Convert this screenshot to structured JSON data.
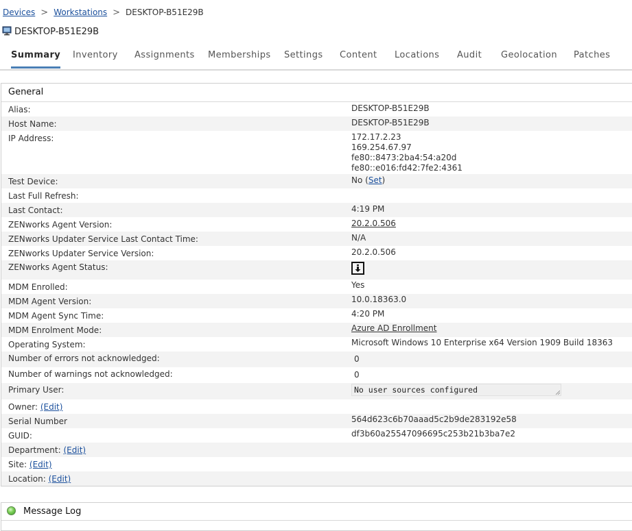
{
  "breadcrumb": {
    "items": [
      "Devices",
      "Workstations"
    ],
    "current": "DESKTOP-B51E29B",
    "separator": ">"
  },
  "page": {
    "title": "DESKTOP-B51E29B",
    "icon": "monitor-icon"
  },
  "tabs": [
    {
      "label": "Summary",
      "active": true
    },
    {
      "label": "Inventory"
    },
    {
      "label": "Assignments"
    },
    {
      "label": "Memberships"
    },
    {
      "label": "Settings"
    },
    {
      "label": "Content"
    },
    {
      "label": "Locations"
    },
    {
      "label": "Audit"
    },
    {
      "label": "Geolocation"
    },
    {
      "label": "Patches"
    }
  ],
  "general": {
    "title": "General",
    "alias": {
      "label": "Alias:",
      "value": "DESKTOP-B51E29B"
    },
    "host_name": {
      "label": "Host Name:",
      "value": "DESKTOP-B51E29B"
    },
    "ip_address": {
      "label": "IP Address:",
      "values": [
        "172.17.2.23",
        "169.254.67.97",
        "fe80::8473:2ba4:54:a20d",
        "fe80::e016:fd42:7fe2:4361"
      ]
    },
    "test_device": {
      "label": "Test Device:",
      "value": "No",
      "action": "Set"
    },
    "last_full_refresh": {
      "label": "Last Full Refresh:",
      "value": ""
    },
    "last_contact": {
      "label": "Last Contact:",
      "value": "4:19 PM"
    },
    "agent_version": {
      "label": "ZENworks Agent Version:",
      "value": "20.2.0.506"
    },
    "updater_contact": {
      "label": "ZENworks Updater Service Last Contact Time:",
      "value": "N/A"
    },
    "updater_version": {
      "label": "ZENworks Updater Service Version:",
      "value": "20.2.0.506"
    },
    "agent_status": {
      "label": "ZENworks Agent Status:",
      "icon": "agent-status-icon"
    },
    "mdm_enrolled": {
      "label": "MDM Enrolled:",
      "value": "Yes"
    },
    "mdm_agent_version": {
      "label": "MDM Agent Version:",
      "value": "10.0.18363.0"
    },
    "mdm_sync_time": {
      "label": "MDM Agent Sync Time:",
      "value": "4:20 PM"
    },
    "mdm_enrolment_mode": {
      "label": "MDM Enrolment Mode:",
      "value": "Azure AD Enrollment"
    },
    "os": {
      "label": "Operating System:",
      "value": "Microsoft Windows 10 Enterprise x64 Version 1909 Build 18363"
    },
    "errors": {
      "label": "Number of errors not acknowledged:",
      "value": "0"
    },
    "warnings": {
      "label": "Number of warnings not acknowledged:",
      "value": "0"
    },
    "primary_user": {
      "label": "Primary User:",
      "value": "No user sources configured"
    },
    "owner": {
      "label": "Owner:",
      "action": "(Edit)"
    },
    "serial_number": {
      "label": "Serial Number",
      "value": "564d623c6b70aaad5c2b9de283192e58"
    },
    "guid": {
      "label": "GUID:",
      "value": "df3b60a25547096695c253b21b3ba7e2"
    },
    "department": {
      "label": "Department:",
      "action": "(Edit)"
    },
    "site": {
      "label": "Site:",
      "action": "(Edit)"
    },
    "location": {
      "label": "Location:",
      "action": "(Edit)"
    }
  },
  "message_log": {
    "title": "Message Log",
    "status_color": "#5cc23a"
  },
  "colors": {
    "link": "#1a4f9c",
    "active_tab_underline": "#4a7fb5",
    "alt_row": "#f3f3f3"
  }
}
